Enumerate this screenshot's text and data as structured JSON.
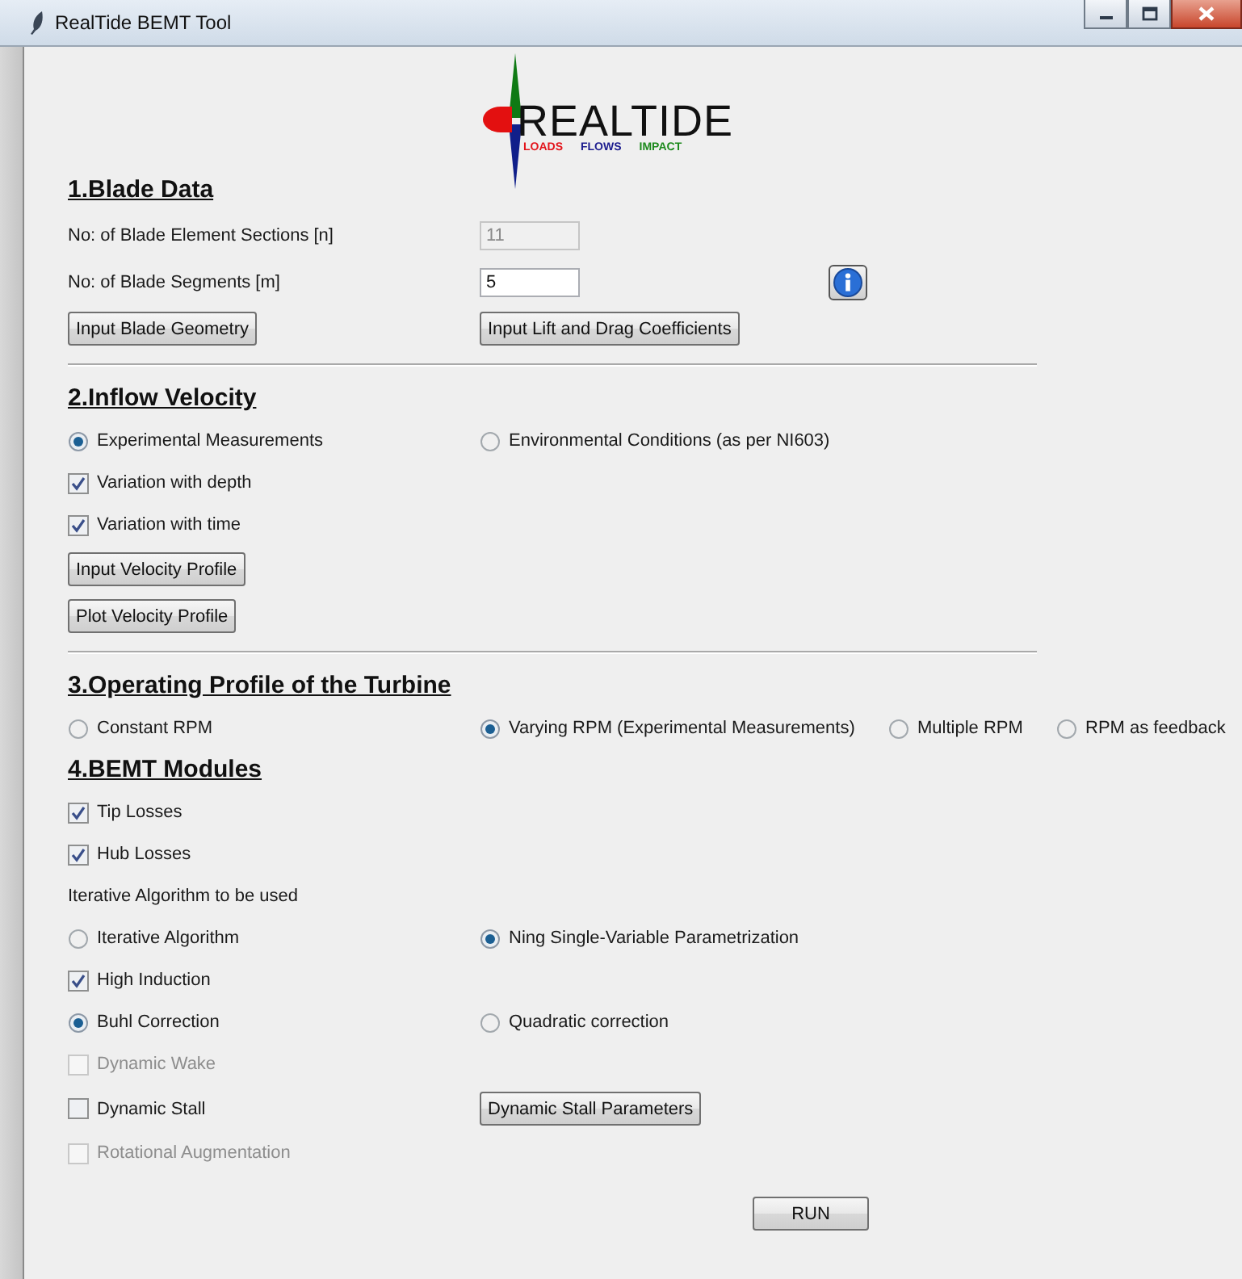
{
  "window": {
    "title": "RealTide BEMT Tool"
  },
  "logo": {
    "wordmark": "REALTIDE",
    "taglines": [
      {
        "text": "LOADS",
        "color": "#e3141b"
      },
      {
        "text": "FLOWS",
        "color": "#1c1c8e"
      },
      {
        "text": "IMPACT",
        "color": "#1d8a1d"
      }
    ]
  },
  "sections": [
    {
      "heading": "1.Blade Data",
      "divider": true,
      "rows": [
        {
          "items": [
            {
              "kind": "label",
              "text": "No: of Blade Element Sections [n]"
            },
            {
              "kind": "field",
              "value": "11",
              "disabled": true
            }
          ]
        },
        {
          "items": [
            {
              "kind": "label",
              "text": "No: of Blade Segments [m]"
            },
            {
              "kind": "field",
              "value": "5",
              "disabled": false
            },
            {
              "kind": "info"
            }
          ]
        },
        {
          "items": [
            {
              "kind": "button",
              "label": "Input Blade Geometry"
            },
            {
              "kind": "button",
              "label": "Input Lift and Drag Coefficients"
            }
          ]
        }
      ]
    },
    {
      "heading": "2.Inflow Velocity",
      "divider": true,
      "rows": [
        {
          "items": [
            {
              "kind": "radio",
              "label": "Experimental Measurements",
              "selected": true
            },
            {
              "kind": "radio",
              "label": "Environmental Conditions (as per NI603)",
              "selected": false
            }
          ]
        },
        {
          "items": [
            {
              "kind": "checkbox",
              "label": "Variation with depth",
              "checked": true,
              "disabled": false
            }
          ]
        },
        {
          "items": [
            {
              "kind": "checkbox",
              "label": "Variation with time",
              "checked": true,
              "disabled": false
            }
          ]
        },
        {
          "items": [
            {
              "kind": "button",
              "label": "Input Velocity Profile"
            }
          ]
        },
        {
          "items": [
            {
              "kind": "button",
              "label": "Plot Velocity Profile"
            }
          ]
        }
      ]
    },
    {
      "heading": "3.Operating Profile of the Turbine",
      "divider": false,
      "rows": [
        {
          "items": [
            {
              "kind": "radio",
              "label": "Constant RPM",
              "selected": false
            },
            {
              "kind": "radio",
              "label": "Varying RPM (Experimental Measurements)",
              "selected": true
            },
            {
              "kind": "radio",
              "label": "Multiple RPM",
              "selected": false
            },
            {
              "kind": "radio",
              "label": "RPM as feedback",
              "selected": false
            }
          ]
        }
      ]
    },
    {
      "heading": "4.BEMT Modules",
      "divider": false,
      "rows": [
        {
          "items": [
            {
              "kind": "checkbox",
              "label": "Tip Losses",
              "checked": true,
              "disabled": false
            }
          ]
        },
        {
          "items": [
            {
              "kind": "checkbox",
              "label": "Hub Losses",
              "checked": true,
              "disabled": false
            }
          ]
        },
        {
          "items": [
            {
              "kind": "label",
              "text": "Iterative Algorithm to be used"
            }
          ]
        },
        {
          "items": [
            {
              "kind": "radio",
              "label": "Iterative Algorithm",
              "selected": false
            },
            {
              "kind": "radio",
              "label": "Ning Single-Variable Parametrization",
              "selected": true
            }
          ]
        },
        {
          "items": [
            {
              "kind": "checkbox",
              "label": "High Induction",
              "checked": true,
              "disabled": false
            }
          ]
        },
        {
          "items": [
            {
              "kind": "radio",
              "label": "Buhl Correction",
              "selected": true
            },
            {
              "kind": "radio",
              "label": "Quadratic correction",
              "selected": false
            }
          ]
        },
        {
          "items": [
            {
              "kind": "checkbox",
              "label": "Dynamic Wake",
              "checked": false,
              "disabled": true
            }
          ]
        },
        {
          "items": [
            {
              "kind": "checkbox",
              "label": "Dynamic Stall",
              "checked": false,
              "disabled": false
            },
            {
              "kind": "button",
              "label": "Dynamic Stall Parameters"
            }
          ]
        },
        {
          "items": [
            {
              "kind": "checkbox",
              "label": "Rotational Augmentation",
              "checked": false,
              "disabled": true
            }
          ]
        }
      ]
    }
  ],
  "run_button": {
    "label": "RUN"
  }
}
